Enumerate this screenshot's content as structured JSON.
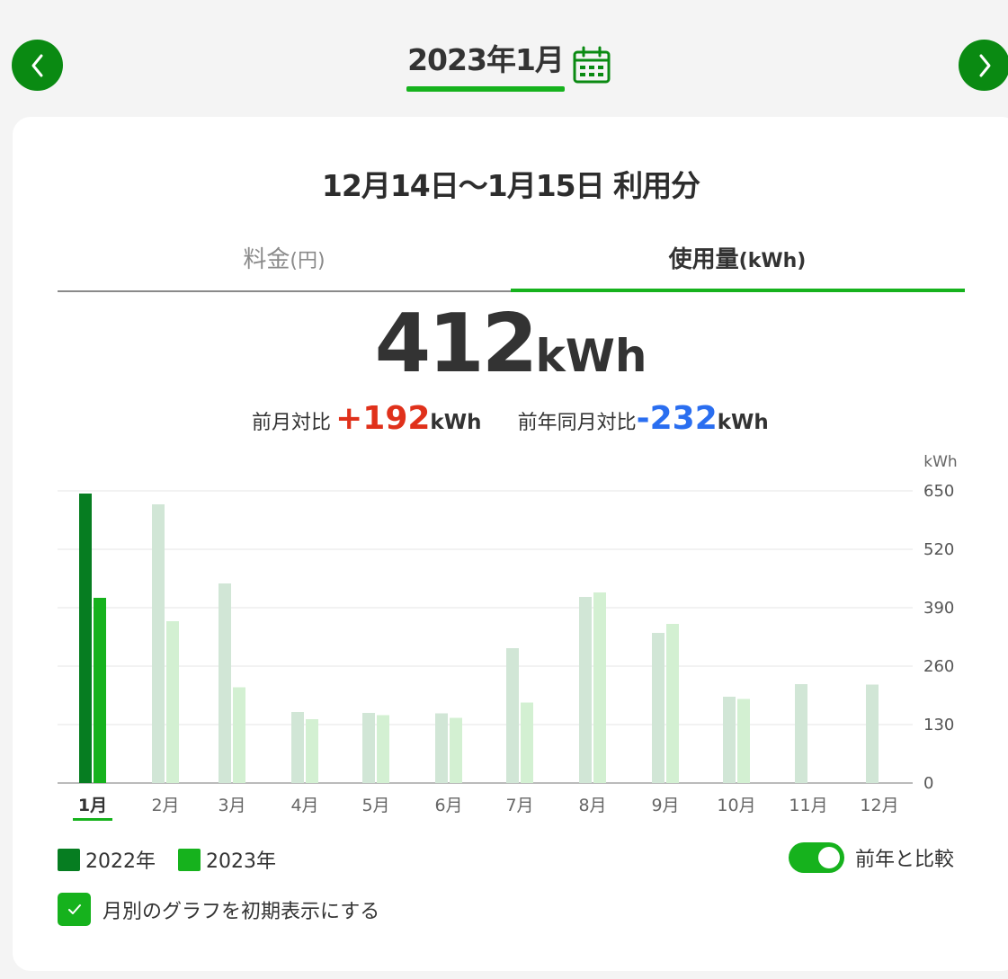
{
  "header": {
    "month_title": "2023年1月",
    "prev_icon": "chevron-left-icon",
    "next_icon": "chevron-right-icon",
    "calendar_icon": "calendar-icon"
  },
  "period": "12月14日～1月15日 利用分",
  "tabs": [
    {
      "label": "料金",
      "unit": "(円)",
      "active": false
    },
    {
      "label": "使用量",
      "unit": "(kWh)",
      "active": true
    }
  ],
  "usage": {
    "value": "412",
    "unit": "kWh"
  },
  "comparison": {
    "prev_month_label": "前月対比",
    "prev_month_value": "+192",
    "prev_month_unit": "kWh",
    "prev_year_label": "前年同月対比",
    "prev_year_value": "-232",
    "prev_year_unit": "kWh"
  },
  "chart_data": {
    "type": "bar",
    "y_unit": "kWh",
    "ylim": [
      0,
      650
    ],
    "yticks": [
      0,
      130,
      260,
      390,
      520,
      650
    ],
    "categories": [
      "1月",
      "2月",
      "3月",
      "4月",
      "5月",
      "6月",
      "7月",
      "8月",
      "9月",
      "10月",
      "11月",
      "12月"
    ],
    "selected_category": "1月",
    "series": [
      {
        "name": "2022年",
        "values": [
          644,
          620,
          444,
          158,
          156,
          155,
          300,
          414,
          334,
          192,
          220,
          219
        ]
      },
      {
        "name": "2023年",
        "values": [
          412,
          360,
          213,
          142,
          151,
          145,
          179,
          424,
          354,
          187,
          null,
          null
        ]
      }
    ],
    "colors": {
      "series_2022": "#067d21",
      "series_2023": "#16b21d",
      "dim_2022": "#d1e6d6",
      "dim_2023": "#d3f0d2"
    },
    "grid": true
  },
  "legend": [
    {
      "label": "2022年",
      "color": "#067d21"
    },
    {
      "label": "2023年",
      "color": "#16b21d"
    }
  ],
  "compare_toggle": {
    "label": "前年と比較",
    "on": true
  },
  "default_view_checkbox": {
    "label": "月別のグラフを初期表示にする",
    "checked": true
  }
}
